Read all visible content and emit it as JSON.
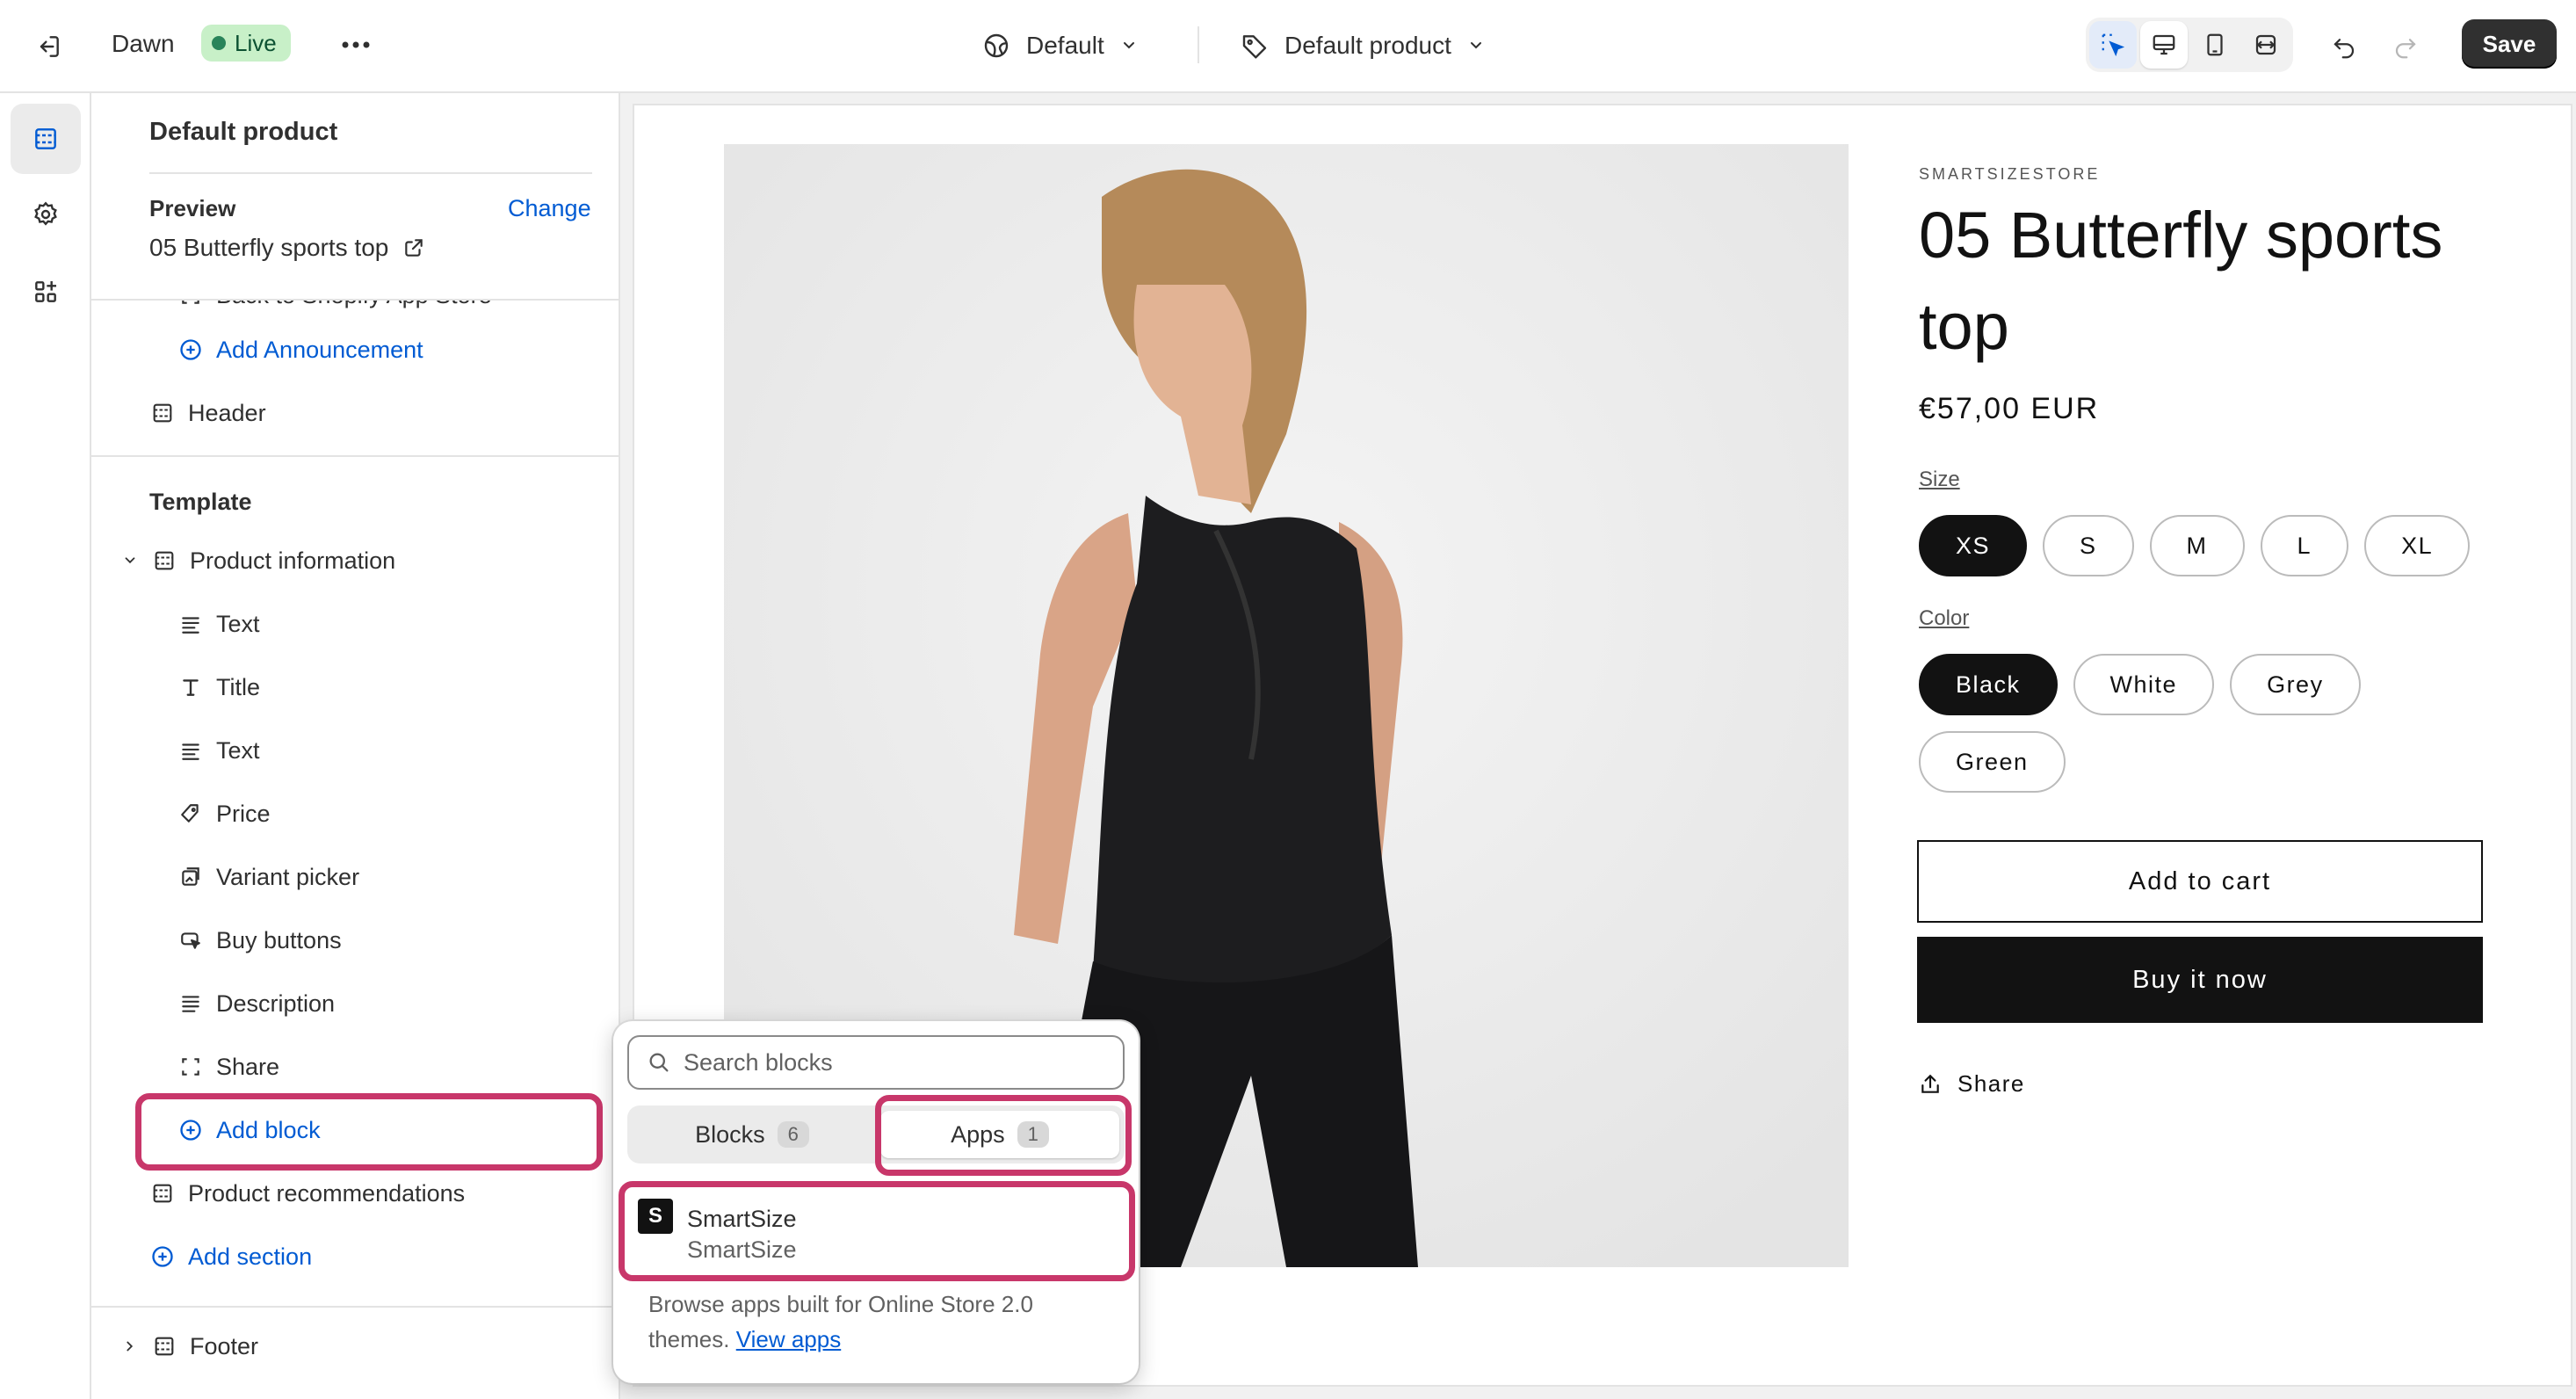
{
  "topbar": {
    "theme_name": "Dawn",
    "status": "Live",
    "more": "•••",
    "market_select": "Default",
    "template_select": "Default product",
    "save_label": "Save"
  },
  "sidebar": {
    "title": "Default product",
    "preview_label": "Preview",
    "change_label": "Change",
    "preview_value": "05 Butterfly sports top",
    "clipped_item": "Back to Shopify App Store",
    "add_announcement": "Add Announcement",
    "header": "Header",
    "template_label": "Template",
    "product_information": "Product information",
    "blocks": [
      "Text",
      "Title",
      "Text",
      "Price",
      "Variant picker",
      "Buy buttons",
      "Description",
      "Share"
    ],
    "add_block": "Add block",
    "product_recommendations": "Product recommendations",
    "add_section": "Add section",
    "footer": "Footer"
  },
  "product": {
    "shop_name": "SMARTSIZESTORE",
    "title": "05 Butterfly sports top",
    "price": "€57,00 EUR",
    "size_label": "Size",
    "sizes": [
      "XS",
      "S",
      "M",
      "L",
      "XL"
    ],
    "selected_size": "XS",
    "color_label": "Color",
    "colors": [
      "Black",
      "White",
      "Grey",
      "Green"
    ],
    "selected_color": "Black",
    "add_to_cart": "Add to cart",
    "buy_now": "Buy it now",
    "share": "Share"
  },
  "popover": {
    "search_placeholder": "Search blocks",
    "tabs": [
      {
        "label": "Blocks",
        "count": "6"
      },
      {
        "label": "Apps",
        "count": "1"
      }
    ],
    "active_tab": "Apps",
    "app_name": "SmartSize",
    "app_vendor": "SmartSize",
    "footer_text": "Browse apps built for Online Store 2.0 themes.",
    "footer_link": "View apps"
  },
  "colors": {
    "accent_blue": "#005bd3",
    "highlight": "#c8376a",
    "live_badge": "#c8f0c8",
    "dark": "#121212"
  }
}
